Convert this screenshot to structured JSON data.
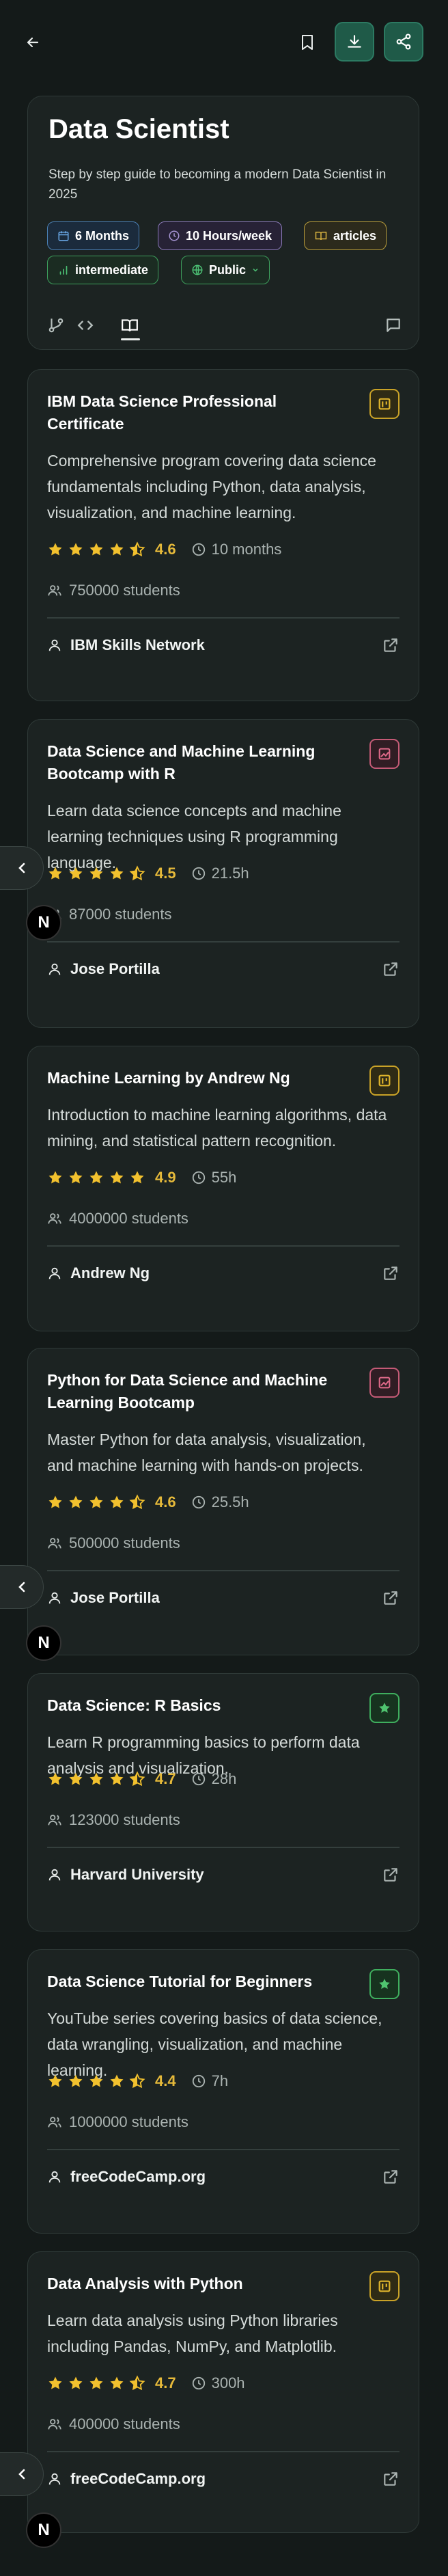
{
  "header": {
    "title": "Data Scientist",
    "description": "Step by step guide to becoming a modern Data Scientist in 2025",
    "tags": {
      "duration": "6 Months",
      "hours": "10 Hours/week",
      "type": "articles",
      "level": "intermediate",
      "visibility": "Public"
    }
  },
  "side_overlay": {
    "badge_letter": "N"
  },
  "courses": [
    {
      "title": "IBM Data Science Professional Certificate",
      "description": "Comprehensive program covering data science fundamentals including Python, data analysis, visualization, and machine learning.",
      "rating": "4.6",
      "rating_value": 4.6,
      "duration": "10 months",
      "students": "750000 students",
      "author": "IBM Skills Network",
      "badge_color": "yellow"
    },
    {
      "title": "Data Science and Machine Learning Bootcamp with R",
      "description": "Learn data science concepts and machine learning techniques using R programming language.",
      "rating": "4.5",
      "rating_value": 4.5,
      "duration": "21.5h",
      "students": "87000 students",
      "author": "Jose Portilla",
      "badge_color": "pink"
    },
    {
      "title": "Machine Learning by Andrew Ng",
      "description": "Introduction to machine learning algorithms, data mining, and statistical pattern recognition.",
      "rating": "4.9",
      "rating_value": 4.9,
      "duration": "55h",
      "students": "4000000 students",
      "author": "Andrew Ng",
      "badge_color": "yellow"
    },
    {
      "title": "Python for Data Science and Machine Learning Bootcamp",
      "description": "Master Python for data analysis, visualization, and machine learning with hands-on projects.",
      "rating": "4.6",
      "rating_value": 4.6,
      "duration": "25.5h",
      "students": "500000 students",
      "author": "Jose Portilla",
      "badge_color": "pink"
    },
    {
      "title": "Data Science: R Basics",
      "description": "Learn R programming basics to perform data analysis and visualization.",
      "rating": "4.7",
      "rating_value": 4.7,
      "duration": "28h",
      "students": "123000 students",
      "author": "Harvard University",
      "badge_color": "green"
    },
    {
      "title": "Data Science Tutorial for Beginners",
      "description": "YouTube series covering basics of data science, data wrangling, visualization, and machine learning.",
      "rating": "4.4",
      "rating_value": 4.4,
      "duration": "7h",
      "students": "1000000 students",
      "author": "freeCodeCamp.org",
      "badge_color": "green"
    },
    {
      "title": "Data Analysis with Python",
      "description": "Learn data analysis using Python libraries including Pandas, NumPy, and Matplotlib.",
      "rating": "4.7",
      "rating_value": 4.7,
      "duration": "300h",
      "students": "400000 students",
      "author": "freeCodeCamp.org",
      "badge_color": "yellow"
    }
  ],
  "colors": {
    "background": "#141a19",
    "card": "#1c2322",
    "accent_green": "#1f5a48",
    "star": "#f2c12e",
    "rating_text": "#e5b93a"
  }
}
